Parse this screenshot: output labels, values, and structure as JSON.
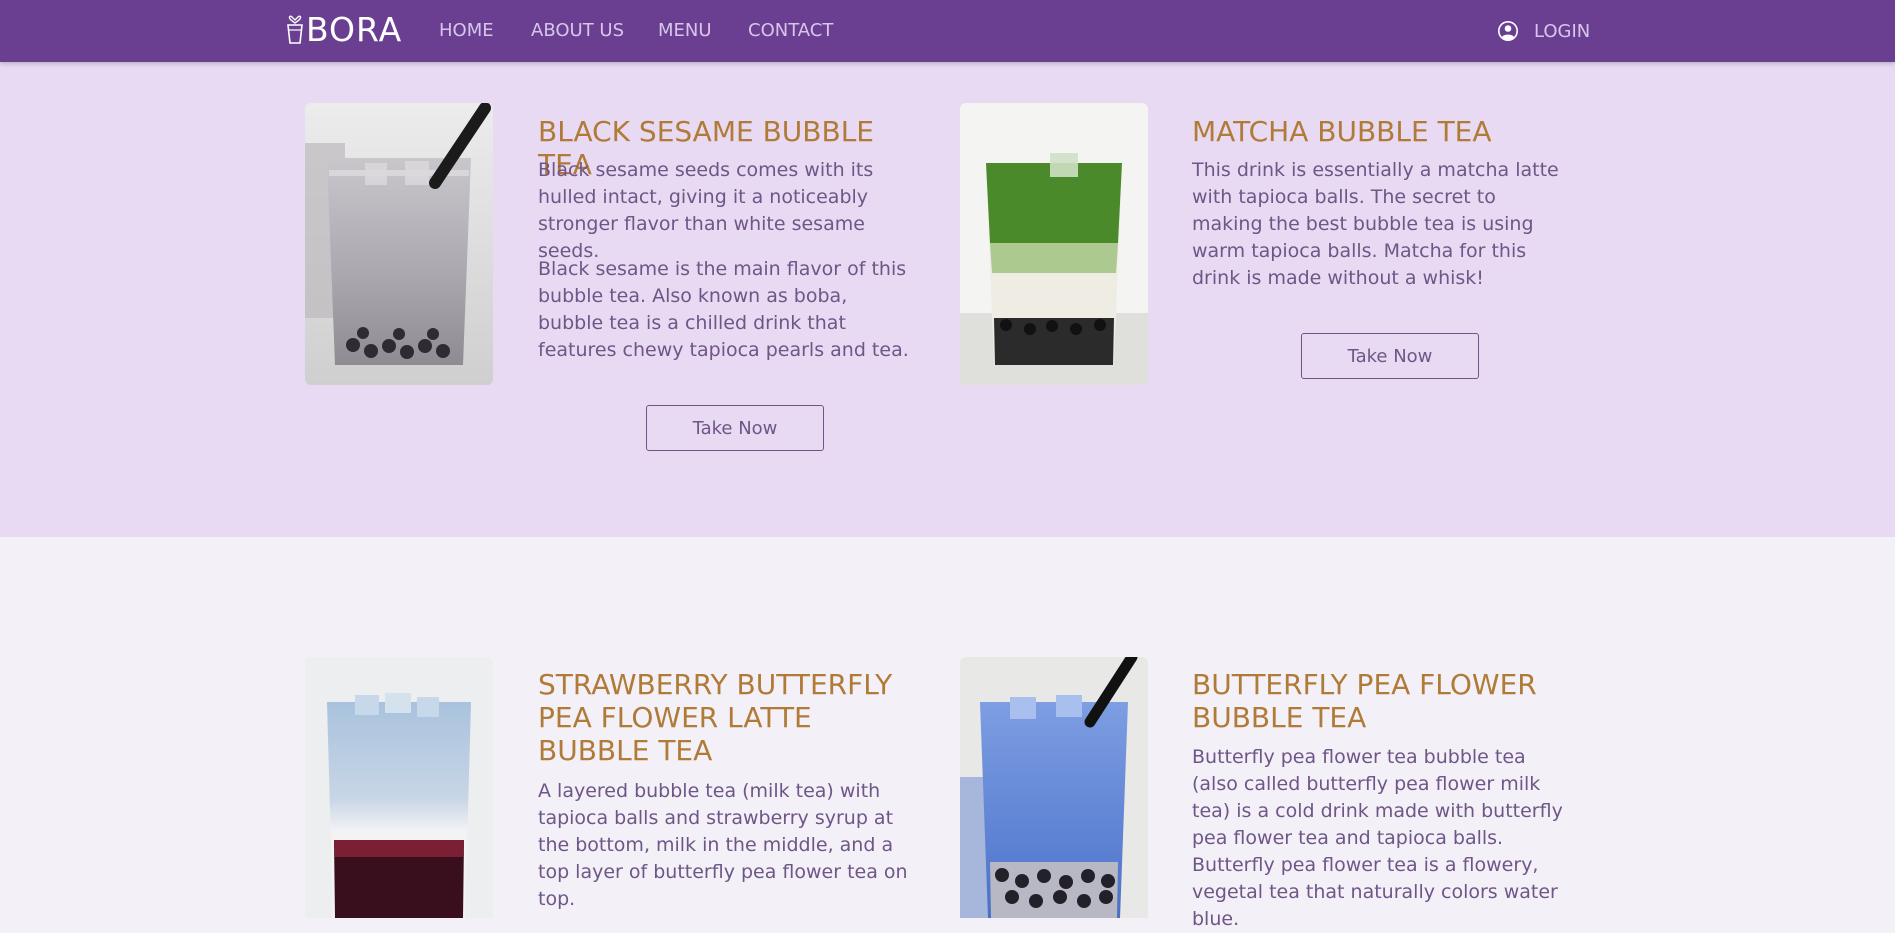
{
  "brand": {
    "name": "BORA"
  },
  "nav": {
    "items": [
      "HOME",
      "ABOUT US",
      "MENU",
      "CONTACT"
    ],
    "login_label": "LOGIN"
  },
  "colors": {
    "navbar": "#6a3f91",
    "section_top_bg": "#e8daf2",
    "section_bottom_bg": "#f3f0f8",
    "title": "#b07a37",
    "text": "#6e5687"
  },
  "products": [
    {
      "title": "BLACK SESAME BUBBLE TEA",
      "paragraphs": [
        "Black sesame seeds comes with its hulled intact, giving it a noticeably stronger flavor than white sesame seeds.",
        "Black sesame is the main flavor of this bubble tea. Also known as boba, bubble tea is a chilled drink that features chewy tapioca pearls and tea."
      ],
      "button": "Take Now"
    },
    {
      "title": "MATCHA BUBBLE TEA",
      "paragraphs": [
        "This drink is essentially a matcha latte with tapioca balls. The secret to making the best bubble tea is using warm tapioca balls. Matcha for this drink is made without a whisk!"
      ],
      "button": "Take Now"
    },
    {
      "title": "STRAWBERRY BUTTERFLY PEA FLOWER LATTE BUBBLE TEA",
      "paragraphs": [
        "A layered bubble tea (milk tea) with tapioca balls and strawberry syrup at the bottom, milk in the middle, and a top layer of butterfly pea flower tea on top."
      ]
    },
    {
      "title": "BUTTERFLY PEA FLOWER BUBBLE TEA",
      "paragraphs": [
        "Butterfly pea flower tea bubble tea (also called butterfly pea flower milk tea) is a cold drink made with butterfly pea flower tea and tapioca balls. Butterfly pea flower tea is a flowery, vegetal tea that naturally colors water blue."
      ]
    }
  ]
}
